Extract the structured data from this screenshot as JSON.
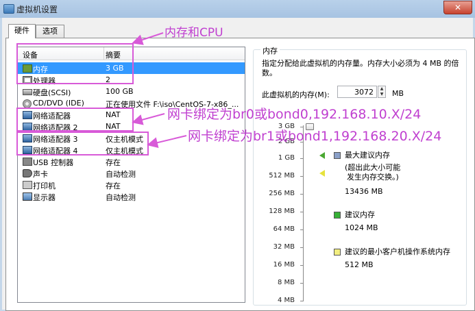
{
  "window": {
    "title": "虚拟机设置",
    "close_glyph": "✕"
  },
  "tabs": [
    {
      "label": "硬件"
    },
    {
      "label": "选项"
    }
  ],
  "device_list": {
    "col_device": "设备",
    "col_summary": "摘要",
    "rows": [
      {
        "name": "内存",
        "summary": "3 GB",
        "icon": "memory-icon"
      },
      {
        "name": "处理器",
        "summary": "2",
        "icon": "cpu-icon"
      },
      {
        "name": "硬盘(SCSI)",
        "summary": "100 GB",
        "icon": "disk-icon"
      },
      {
        "name": "CD/DVD (IDE)",
        "summary": "正在使用文件 F:\\iso\\CentOS-7-x86_...",
        "icon": "cd-icon"
      },
      {
        "name": "网络适配器",
        "summary": "NAT",
        "icon": "network-icon"
      },
      {
        "name": "网络适配器 2",
        "summary": "NAT",
        "icon": "network-icon"
      },
      {
        "name": "网络适配器 3",
        "summary": "仅主机模式",
        "icon": "network-icon"
      },
      {
        "name": "网络适配器 4",
        "summary": "仅主机模式",
        "icon": "network-icon"
      },
      {
        "name": "USB 控制器",
        "summary": "存在",
        "icon": "usb-icon"
      },
      {
        "name": "声卡",
        "summary": "自动检测",
        "icon": "sound-icon"
      },
      {
        "name": "打印机",
        "summary": "存在",
        "icon": "printer-icon"
      },
      {
        "name": "显示器",
        "summary": "自动检测",
        "icon": "display-icon"
      }
    ]
  },
  "memory": {
    "group_title": "内存",
    "description": "指定分配给此虚拟机的内存量。内存大小必须为 4 MB 的倍数。",
    "input_label": "此虚拟机的内存(M):",
    "input_value": "3072",
    "unit": "MB",
    "scale": [
      "3 GB",
      "2 GB",
      "1 GB",
      "512 MB",
      "256 MB",
      "128 MB",
      "64 MB",
      "32 MB",
      "16 MB",
      "8 MB",
      "4 MB"
    ],
    "legend": {
      "max_title": "最大建议内存",
      "max_note_1": "(超出此大小可能",
      "max_note_2": "发生内存交换。)",
      "max_value": "13436 MB",
      "rec_title": "建议内存",
      "rec_value": "1024 MB",
      "min_title": "建议的最小客户机操作系统内存",
      "min_value": "512 MB"
    },
    "colors": {
      "max": "#4aa832",
      "swap": "#e6e23c",
      "rec": "#36b036",
      "min": "#f2ee80"
    }
  },
  "annotations": {
    "mem_cpu": "内存和CPU",
    "nic_1_2": "网卡绑定为br0或bond0,192.168.10.X/24",
    "nic_3_4": "网卡绑定为br1或bond1,192.168.20.X/24",
    "color": "#d85ad8"
  }
}
